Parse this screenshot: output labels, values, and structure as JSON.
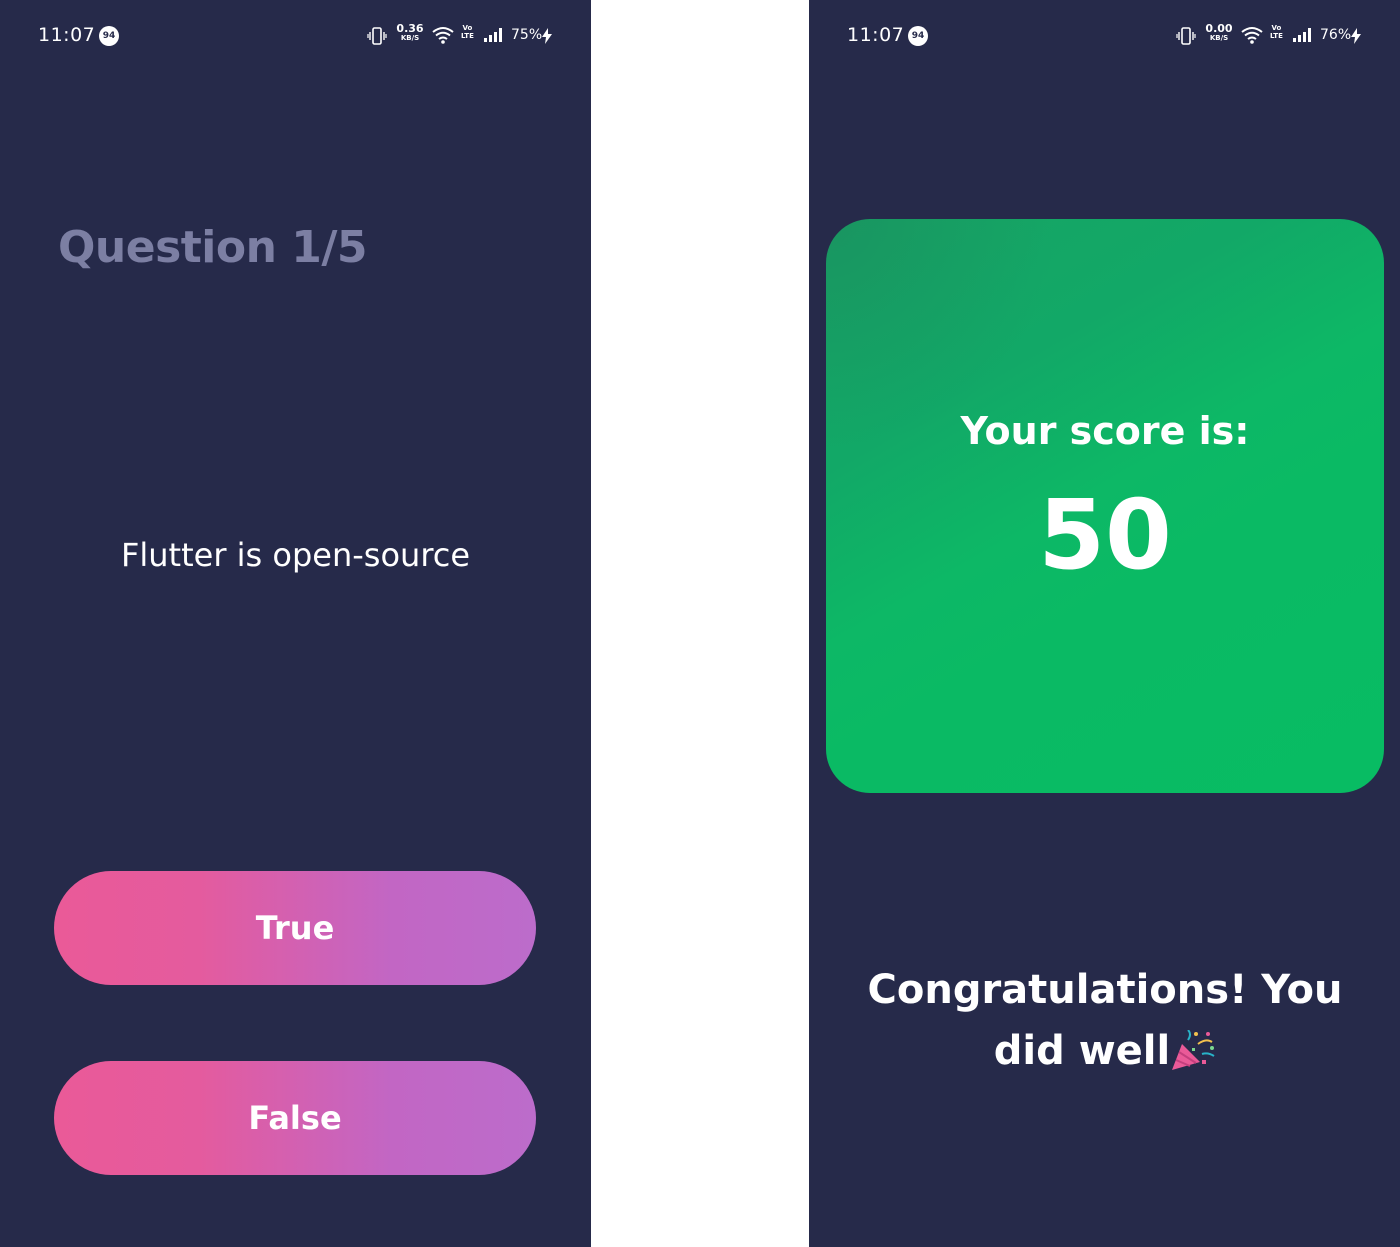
{
  "quiz_screen": {
    "status_bar": {
      "time": "11:07",
      "notification_badge": "94",
      "net_speed_value": "0.36",
      "net_speed_unit": "KB/S",
      "volte_line1": "Vo",
      "volte_line2": "LTE",
      "battery": "75%"
    },
    "question_number": "Question 1/5",
    "question_text": "Flutter is open-source",
    "true_label": "True",
    "false_label": "False"
  },
  "result_screen": {
    "status_bar": {
      "time": "11:07",
      "notification_badge": "94",
      "net_speed_value": "0.00",
      "net_speed_unit": "KB/S",
      "volte_line1": "Vo",
      "volte_line2": "LTE",
      "battery": "76%"
    },
    "score_label": "Your score is:",
    "score_value": "50",
    "congrats_text": "Congratulations! You did well",
    "congrats_icon": "party-popper-icon"
  },
  "colors": {
    "background": "#262a4a",
    "question_number": "#7c7fa3",
    "button_gradient_start": "#ea5a98",
    "button_gradient_end": "#bc6ccb",
    "score_card_green": "#0aba64"
  }
}
